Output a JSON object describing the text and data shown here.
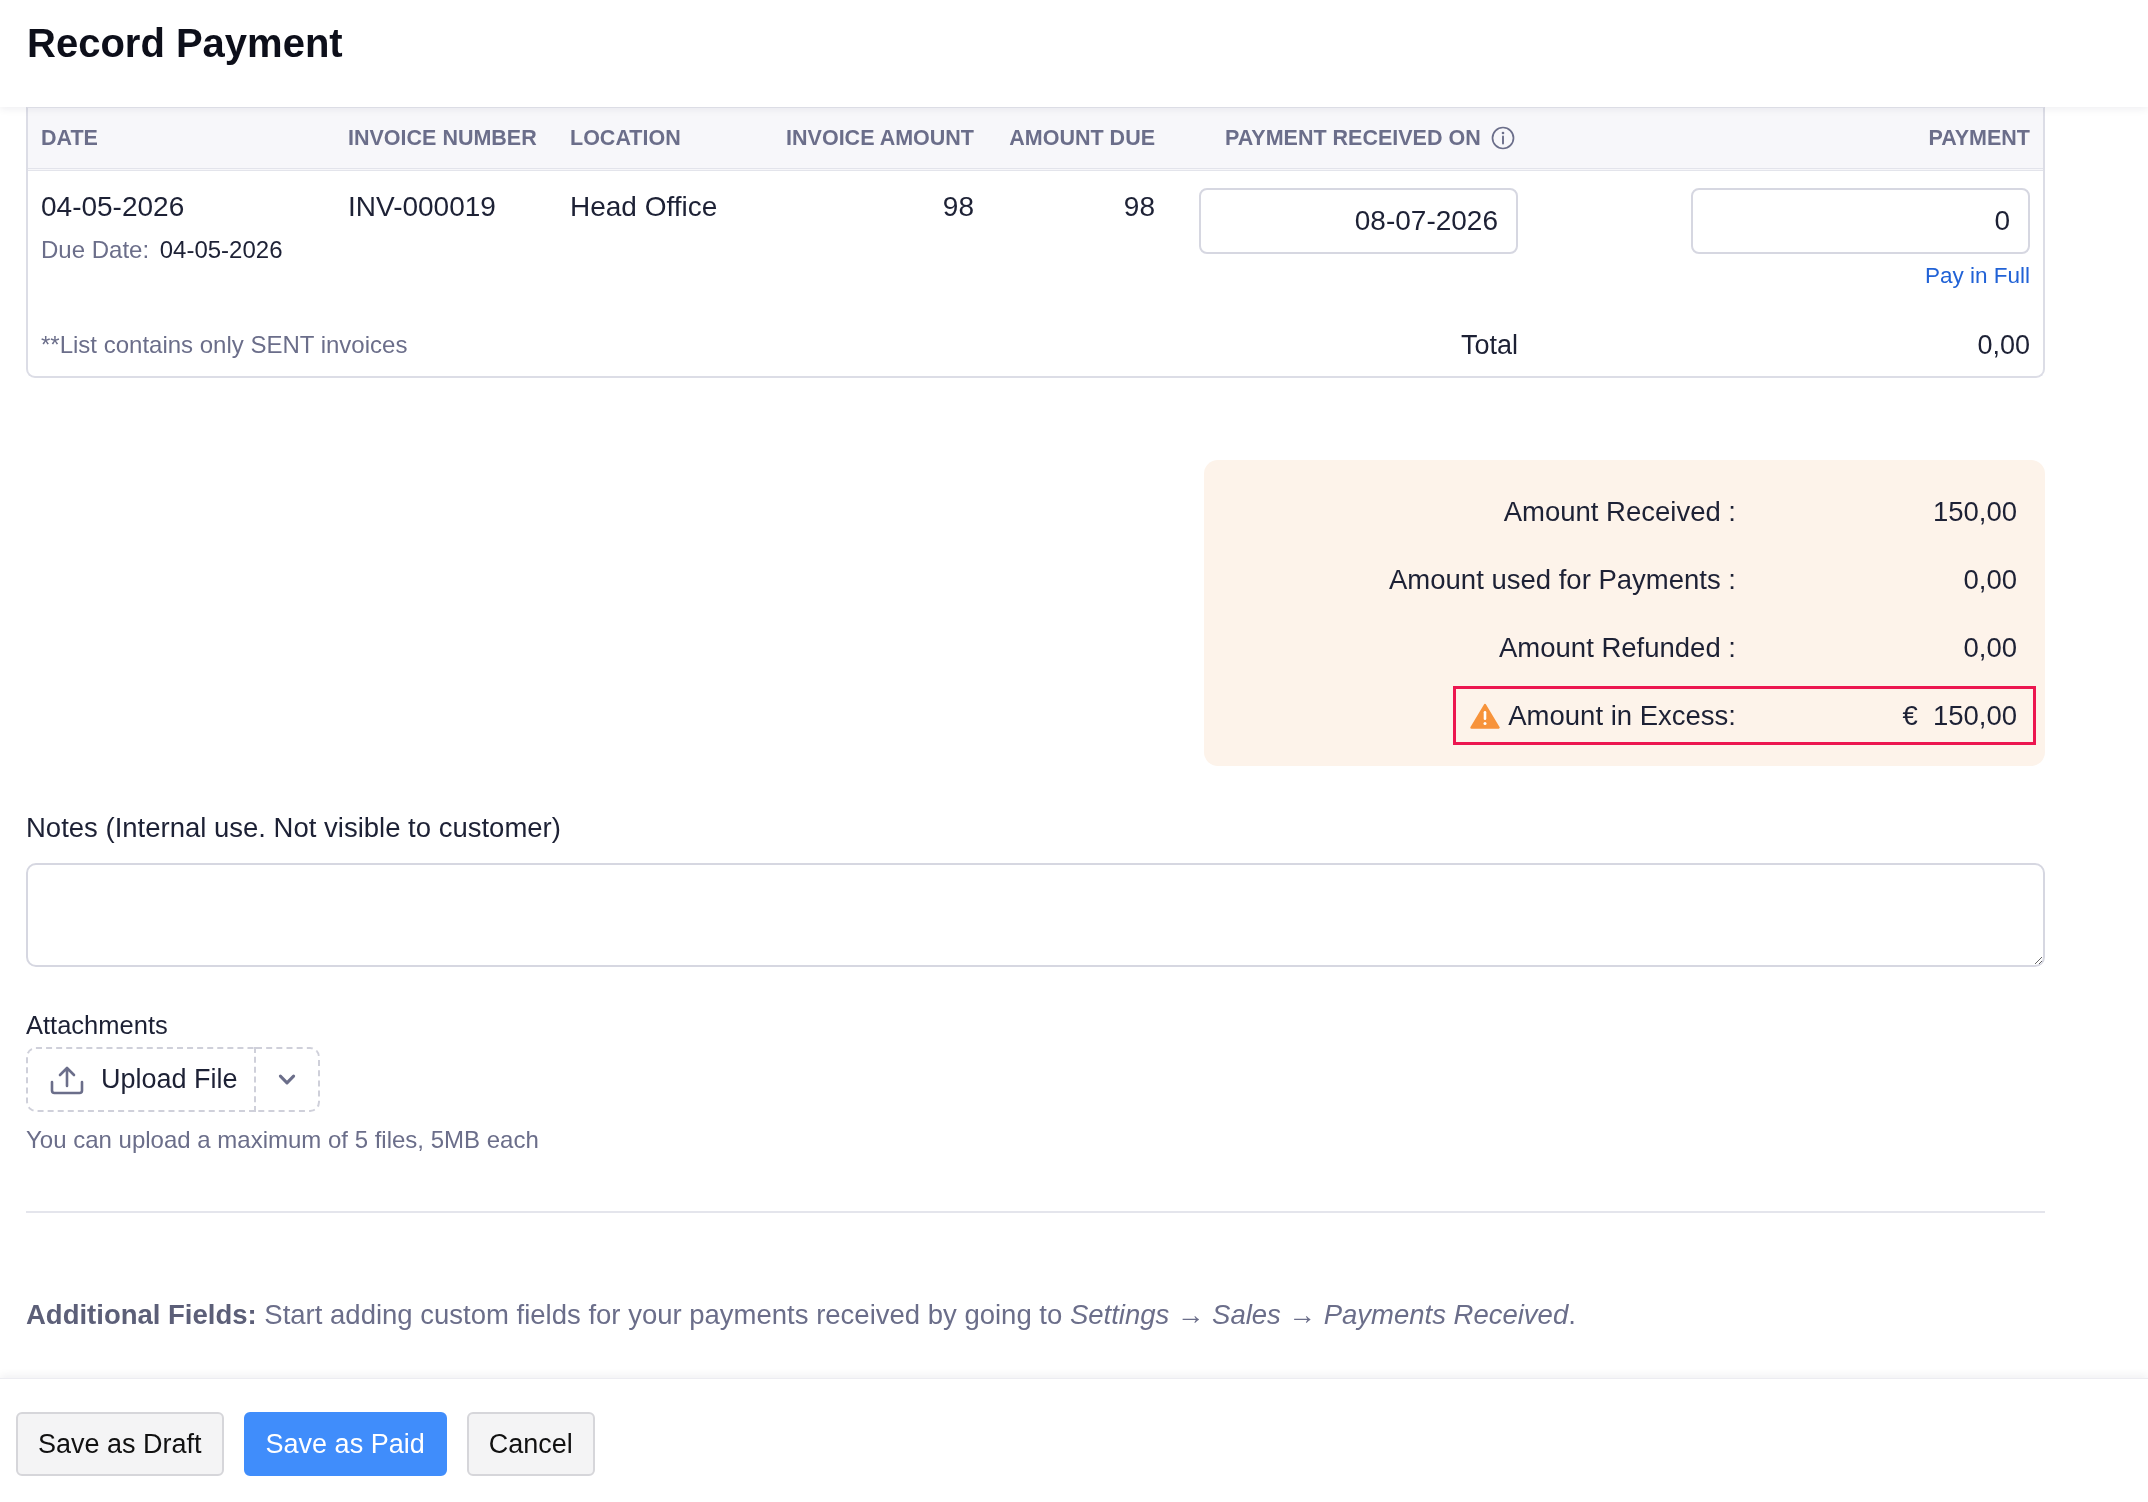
{
  "page": {
    "title": "Record Payment"
  },
  "invoices": {
    "columns": [
      {
        "label": "DATE",
        "info": false
      },
      {
        "label": "INVOICE NUMBER",
        "info": false
      },
      {
        "label": "LOCATION",
        "info": false
      },
      {
        "label": "INVOICE AMOUNT",
        "info": false
      },
      {
        "label": "AMOUNT DUE",
        "info": false
      },
      {
        "label": "PAYMENT RECEIVED ON",
        "info": true
      },
      {
        "label": "PAYMENT",
        "info": false
      }
    ],
    "rows": [
      {
        "date": "04-05-2026",
        "due_date_label": "Due Date:",
        "due_date": "04-05-2026",
        "invoice_number": "INV-000019",
        "location": "Head Office",
        "invoice_amount": "98",
        "amount_due": "98",
        "payment_received_on": "08-07-2026",
        "payment": "0",
        "pay_in_full": "Pay in Full"
      }
    ],
    "footnote": "**List contains only SENT invoices",
    "total_label": "Total",
    "total": "0,00"
  },
  "summary": {
    "rows": [
      {
        "label": "Amount Received :",
        "value": "150,00",
        "highlighted": false,
        "warning": false
      },
      {
        "label": "Amount used for Payments :",
        "value": "0,00",
        "highlighted": false,
        "warning": false
      },
      {
        "label": "Amount Refunded :",
        "value": "0,00",
        "highlighted": false,
        "warning": false
      },
      {
        "label": "Amount in Excess:",
        "currency": "€",
        "value": "150,00",
        "highlighted": true,
        "warning": true
      }
    ]
  },
  "notes": {
    "label": "Notes (Internal use. Not visible to customer)"
  },
  "attachments": {
    "label": "Attachments",
    "upload_label": "Upload File",
    "hint": "You can upload a maximum of 5 files, 5MB each"
  },
  "additional_fields": "**Additional Fields:** Start adding custom fields for your payments received by going to *Settings* → *Sales* → *Payments Received*.",
  "actions": [
    {
      "label": "Save as Draft",
      "kind": "secondary"
    },
    {
      "label": "Save as Paid",
      "kind": "primary"
    },
    {
      "label": "Cancel",
      "kind": "secondary"
    }
  ]
}
